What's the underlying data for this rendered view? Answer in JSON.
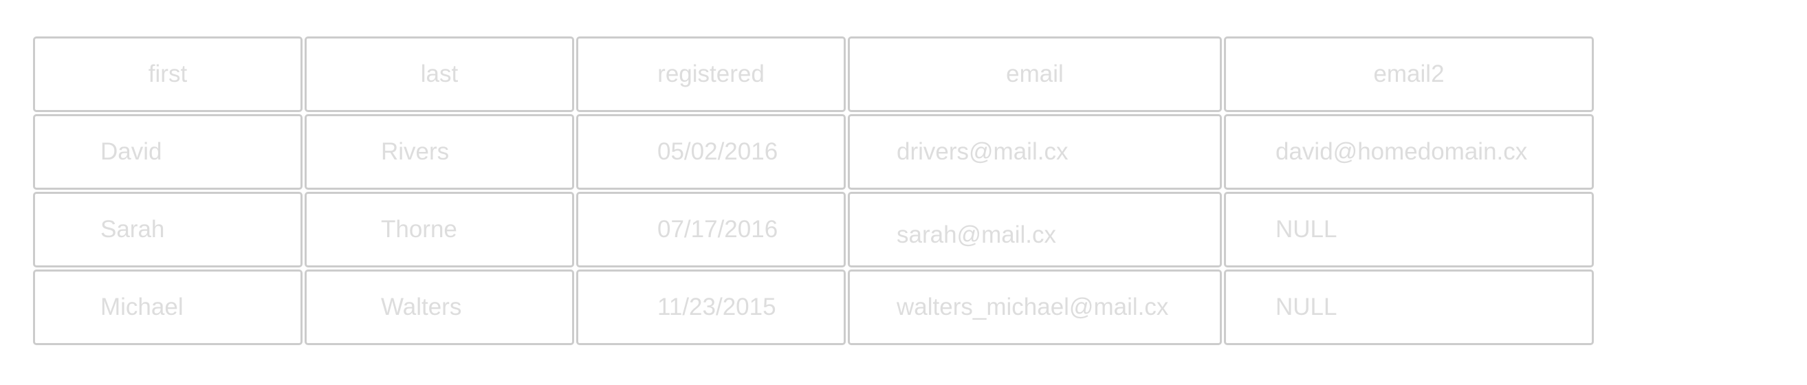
{
  "table": {
    "headers": [
      "first",
      "last",
      "registered",
      "email",
      "email2"
    ],
    "rows": [
      [
        "David",
        "Rivers",
        "05/02/2016",
        "drivers@mail.cx",
        "david@homedomain.cx"
      ],
      [
        "Sarah",
        "Thorne",
        "07/17/2016",
        "sarah@mail.cx",
        "NULL"
      ],
      [
        "Michael",
        "Walters",
        "11/23/2015",
        "walters_michael@mail.cx",
        "NULL"
      ]
    ]
  },
  "colors": {
    "border": "#cccccc",
    "text": "#dddddd",
    "background": "#ffffff"
  }
}
